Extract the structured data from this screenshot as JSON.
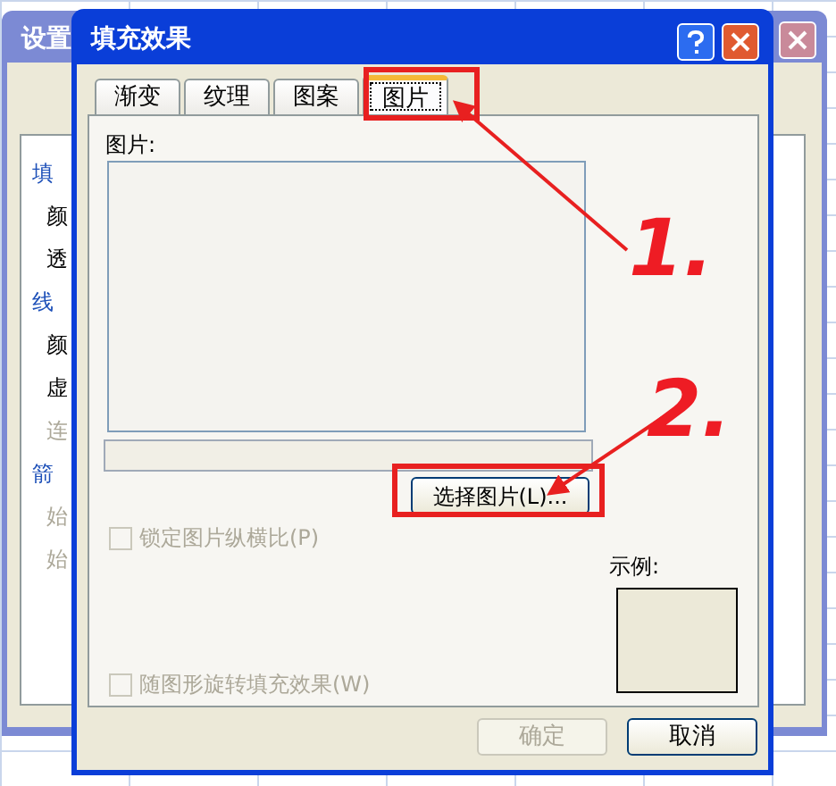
{
  "back_window": {
    "title": "设置",
    "items": [
      {
        "label": "填",
        "kind": "heading",
        "disabled": false
      },
      {
        "label": "颜",
        "kind": "item",
        "disabled": false
      },
      {
        "label": "透",
        "kind": "item",
        "disabled": false
      },
      {
        "label": "线",
        "kind": "heading",
        "disabled": false
      },
      {
        "label": "颜",
        "kind": "item",
        "disabled": false
      },
      {
        "label": "虚",
        "kind": "item",
        "disabled": false
      },
      {
        "label": "连",
        "kind": "item",
        "disabled": true
      },
      {
        "label": "箭",
        "kind": "heading",
        "disabled": false
      },
      {
        "label": "始",
        "kind": "item",
        "disabled": true
      },
      {
        "label": "始",
        "kind": "item",
        "disabled": true
      }
    ]
  },
  "dialog": {
    "title": "填充效果",
    "tabs": [
      {
        "label": "渐变",
        "selected": false
      },
      {
        "label": "纹理",
        "selected": false
      },
      {
        "label": "图案",
        "selected": false
      },
      {
        "label": "图片",
        "selected": true
      }
    ],
    "picture_label": "图片:",
    "select_button": "选择图片(L)...",
    "checkboxes": [
      {
        "label": "锁定图片纵横比(P)",
        "checked": false,
        "disabled": true
      },
      {
        "label": "随图形旋转填充效果(W)",
        "checked": false,
        "disabled": true
      }
    ],
    "sample_label": "示例:",
    "buttons": [
      {
        "label": "确定",
        "disabled": true
      },
      {
        "label": "取消",
        "disabled": false
      }
    ]
  },
  "annotations": [
    "1.",
    "2."
  ]
}
